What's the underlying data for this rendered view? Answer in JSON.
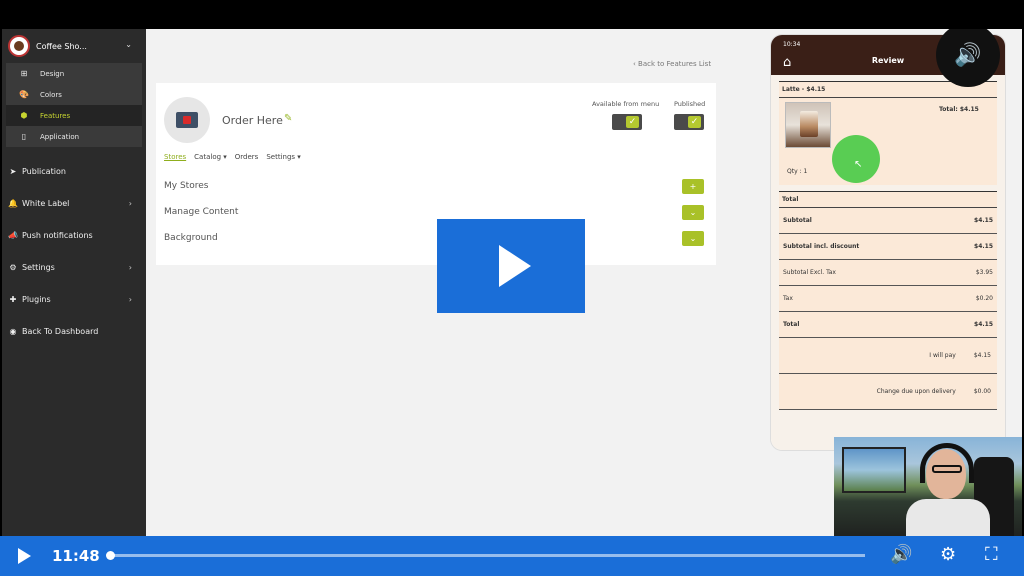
{
  "sidebar": {
    "brand": "Coffee Sho...",
    "submenu": [
      {
        "label": "Design",
        "icon": "design-icon",
        "glyph": "⊞"
      },
      {
        "label": "Colors",
        "icon": "palette-icon",
        "glyph": "🎨"
      },
      {
        "label": "Features",
        "icon": "features-icon",
        "glyph": "⬢"
      },
      {
        "label": "Application",
        "icon": "mobile-icon",
        "glyph": "▯"
      }
    ],
    "nav": [
      {
        "label": "Publication",
        "glyph": "➤"
      },
      {
        "label": "White Label",
        "glyph": "🔔"
      },
      {
        "label": "Push notifications",
        "glyph": "📣"
      },
      {
        "label": "Settings",
        "glyph": "⚙"
      },
      {
        "label": "Plugins",
        "glyph": "✚"
      },
      {
        "label": "Back To Dashboard",
        "glyph": "◉"
      }
    ]
  },
  "main": {
    "back_link": "Back to Features List",
    "feature_title": "Order Here",
    "available_label": "Available from menu",
    "published_label": "Published",
    "tabs": [
      "Stores",
      "Catalog ▾",
      "Orders",
      "Settings ▾"
    ],
    "rows": [
      {
        "label": "My Stores",
        "button": "+"
      },
      {
        "label": "Manage Content",
        "button": "⌄"
      },
      {
        "label": "Background",
        "button": "⌄"
      }
    ]
  },
  "phone": {
    "time": "10:34",
    "title": "Review",
    "item_title": "Latte - $4.15",
    "item_total": "Total: $4.15",
    "qty": "Qty : 1",
    "total_section": "Total",
    "lines": [
      {
        "label": "Subtotal",
        "value": "$4.15",
        "bold": true
      },
      {
        "label": "Subtotal incl. discount",
        "value": "$4.15",
        "bold": true
      },
      {
        "label": "Subtotal Excl. Tax",
        "value": "$3.95",
        "bold": false
      },
      {
        "label": "Tax",
        "value": "$0.20",
        "bold": false
      },
      {
        "label": "Total",
        "value": "$4.15",
        "bold": true
      }
    ],
    "pay_label": "I will pay",
    "pay_value": "$4.15",
    "change_label": "Change due upon delivery",
    "change_value": "$0.00"
  },
  "player": {
    "time": "11:48",
    "progress_fraction": 0.0
  },
  "colors": {
    "accent": "#1a6ed8",
    "sidebar": "#2b2b2b",
    "highlight": "#a9c128"
  }
}
